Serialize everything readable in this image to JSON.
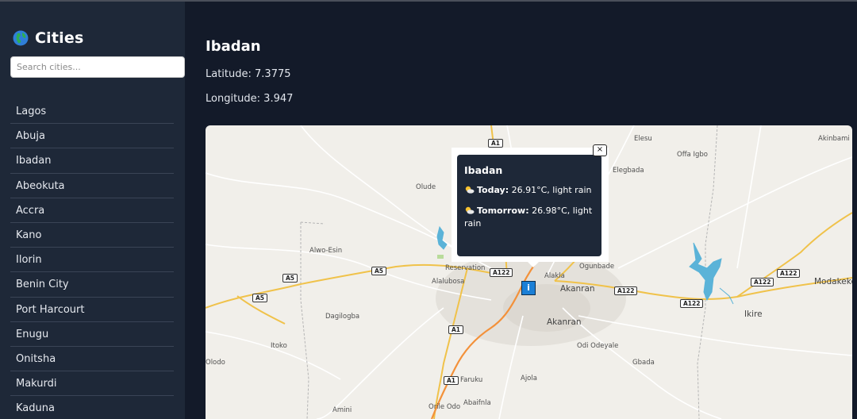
{
  "sidebar": {
    "title": "Cities",
    "search_placeholder": "Search cities...",
    "cities": [
      "Lagos",
      "Abuja",
      "Ibadan",
      "Abeokuta",
      "Accra",
      "Kano",
      "Ilorin",
      "Benin City",
      "Port Harcourt",
      "Enugu",
      "Onitsha",
      "Makurdi",
      "Kaduna"
    ]
  },
  "main": {
    "city_name": "Ibadan",
    "latitude": "Latitude: 7.3775",
    "longitude": "Longitude: 3.947"
  },
  "popup": {
    "title": "Ibadan",
    "today_label": "Today:",
    "today_value": " 26.91°C, light rain",
    "tomorrow_label": "Tomorrow:",
    "tomorrow_value": " 26.98°C, light rain",
    "close_glyph": "×"
  },
  "map": {
    "place_labels": [
      "Elesu",
      "Akinbami",
      "Offa Igbo",
      "Elegbada",
      "Olude",
      "Alwo-Esin",
      "Reservation",
      "Alakla",
      "Ogunbade",
      "Alalubosa",
      "Akanran",
      "Akanran",
      "Modakeke",
      "Ikire",
      "Dagilogba",
      "Itoko",
      "Odi Odeyale",
      "Gbada",
      "Olodo",
      "Faruku",
      "Ajola",
      "Amini",
      "Orile Odo",
      "Abaifnla"
    ],
    "road_shields": [
      "A1",
      "A5",
      "A5",
      "A5",
      "A122",
      "A122",
      "A122",
      "A122",
      "A122",
      "A1",
      "A1"
    ],
    "marker_glyph": "i",
    "colors": {
      "water": "#5bb3d8",
      "road": "#f0c24a",
      "highway": "#f3913a"
    }
  }
}
